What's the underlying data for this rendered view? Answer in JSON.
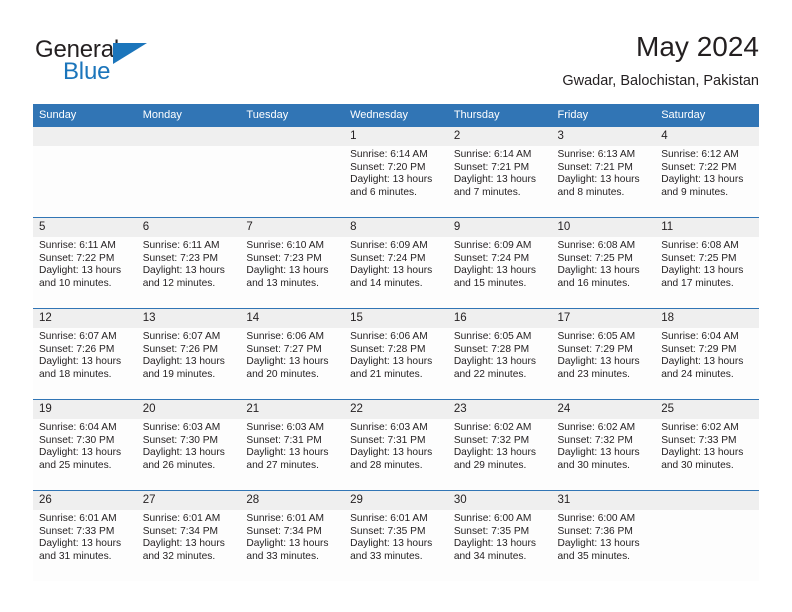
{
  "brand": {
    "name_top": "General",
    "name_bottom": "Blue",
    "accent_color": "#1b75bb"
  },
  "header": {
    "title": "May 2024",
    "subtitle": "Gwadar, Balochistan, Pakistan"
  },
  "theme": {
    "header_row_bg": "#3175b5",
    "daynum_bg": "#efefef",
    "grid_line": "#3175b5",
    "text": "#231f20"
  },
  "weekdays": [
    "Sunday",
    "Monday",
    "Tuesday",
    "Wednesday",
    "Thursday",
    "Friday",
    "Saturday"
  ],
  "labels": {
    "sunrise": "Sunrise:",
    "sunset": "Sunset:",
    "daylight": "Daylight:"
  },
  "weeks": [
    [
      {
        "day": "",
        "empty": true
      },
      {
        "day": "",
        "empty": true
      },
      {
        "day": "",
        "empty": true
      },
      {
        "day": "1",
        "sunrise": "Sunrise: 6:14 AM",
        "sunset": "Sunset: 7:20 PM",
        "daylight": "Daylight: 13 hours and 6 minutes."
      },
      {
        "day": "2",
        "sunrise": "Sunrise: 6:14 AM",
        "sunset": "Sunset: 7:21 PM",
        "daylight": "Daylight: 13 hours and 7 minutes."
      },
      {
        "day": "3",
        "sunrise": "Sunrise: 6:13 AM",
        "sunset": "Sunset: 7:21 PM",
        "daylight": "Daylight: 13 hours and 8 minutes."
      },
      {
        "day": "4",
        "sunrise": "Sunrise: 6:12 AM",
        "sunset": "Sunset: 7:22 PM",
        "daylight": "Daylight: 13 hours and 9 minutes."
      }
    ],
    [
      {
        "day": "5",
        "sunrise": "Sunrise: 6:11 AM",
        "sunset": "Sunset: 7:22 PM",
        "daylight": "Daylight: 13 hours and 10 minutes."
      },
      {
        "day": "6",
        "sunrise": "Sunrise: 6:11 AM",
        "sunset": "Sunset: 7:23 PM",
        "daylight": "Daylight: 13 hours and 12 minutes."
      },
      {
        "day": "7",
        "sunrise": "Sunrise: 6:10 AM",
        "sunset": "Sunset: 7:23 PM",
        "daylight": "Daylight: 13 hours and 13 minutes."
      },
      {
        "day": "8",
        "sunrise": "Sunrise: 6:09 AM",
        "sunset": "Sunset: 7:24 PM",
        "daylight": "Daylight: 13 hours and 14 minutes."
      },
      {
        "day": "9",
        "sunrise": "Sunrise: 6:09 AM",
        "sunset": "Sunset: 7:24 PM",
        "daylight": "Daylight: 13 hours and 15 minutes."
      },
      {
        "day": "10",
        "sunrise": "Sunrise: 6:08 AM",
        "sunset": "Sunset: 7:25 PM",
        "daylight": "Daylight: 13 hours and 16 minutes."
      },
      {
        "day": "11",
        "sunrise": "Sunrise: 6:08 AM",
        "sunset": "Sunset: 7:25 PM",
        "daylight": "Daylight: 13 hours and 17 minutes."
      }
    ],
    [
      {
        "day": "12",
        "sunrise": "Sunrise: 6:07 AM",
        "sunset": "Sunset: 7:26 PM",
        "daylight": "Daylight: 13 hours and 18 minutes."
      },
      {
        "day": "13",
        "sunrise": "Sunrise: 6:07 AM",
        "sunset": "Sunset: 7:26 PM",
        "daylight": "Daylight: 13 hours and 19 minutes."
      },
      {
        "day": "14",
        "sunrise": "Sunrise: 6:06 AM",
        "sunset": "Sunset: 7:27 PM",
        "daylight": "Daylight: 13 hours and 20 minutes."
      },
      {
        "day": "15",
        "sunrise": "Sunrise: 6:06 AM",
        "sunset": "Sunset: 7:28 PM",
        "daylight": "Daylight: 13 hours and 21 minutes."
      },
      {
        "day": "16",
        "sunrise": "Sunrise: 6:05 AM",
        "sunset": "Sunset: 7:28 PM",
        "daylight": "Daylight: 13 hours and 22 minutes."
      },
      {
        "day": "17",
        "sunrise": "Sunrise: 6:05 AM",
        "sunset": "Sunset: 7:29 PM",
        "daylight": "Daylight: 13 hours and 23 minutes."
      },
      {
        "day": "18",
        "sunrise": "Sunrise: 6:04 AM",
        "sunset": "Sunset: 7:29 PM",
        "daylight": "Daylight: 13 hours and 24 minutes."
      }
    ],
    [
      {
        "day": "19",
        "sunrise": "Sunrise: 6:04 AM",
        "sunset": "Sunset: 7:30 PM",
        "daylight": "Daylight: 13 hours and 25 minutes."
      },
      {
        "day": "20",
        "sunrise": "Sunrise: 6:03 AM",
        "sunset": "Sunset: 7:30 PM",
        "daylight": "Daylight: 13 hours and 26 minutes."
      },
      {
        "day": "21",
        "sunrise": "Sunrise: 6:03 AM",
        "sunset": "Sunset: 7:31 PM",
        "daylight": "Daylight: 13 hours and 27 minutes."
      },
      {
        "day": "22",
        "sunrise": "Sunrise: 6:03 AM",
        "sunset": "Sunset: 7:31 PM",
        "daylight": "Daylight: 13 hours and 28 minutes."
      },
      {
        "day": "23",
        "sunrise": "Sunrise: 6:02 AM",
        "sunset": "Sunset: 7:32 PM",
        "daylight": "Daylight: 13 hours and 29 minutes."
      },
      {
        "day": "24",
        "sunrise": "Sunrise: 6:02 AM",
        "sunset": "Sunset: 7:32 PM",
        "daylight": "Daylight: 13 hours and 30 minutes."
      },
      {
        "day": "25",
        "sunrise": "Sunrise: 6:02 AM",
        "sunset": "Sunset: 7:33 PM",
        "daylight": "Daylight: 13 hours and 30 minutes."
      }
    ],
    [
      {
        "day": "26",
        "sunrise": "Sunrise: 6:01 AM",
        "sunset": "Sunset: 7:33 PM",
        "daylight": "Daylight: 13 hours and 31 minutes."
      },
      {
        "day": "27",
        "sunrise": "Sunrise: 6:01 AM",
        "sunset": "Sunset: 7:34 PM",
        "daylight": "Daylight: 13 hours and 32 minutes."
      },
      {
        "day": "28",
        "sunrise": "Sunrise: 6:01 AM",
        "sunset": "Sunset: 7:34 PM",
        "daylight": "Daylight: 13 hours and 33 minutes."
      },
      {
        "day": "29",
        "sunrise": "Sunrise: 6:01 AM",
        "sunset": "Sunset: 7:35 PM",
        "daylight": "Daylight: 13 hours and 33 minutes."
      },
      {
        "day": "30",
        "sunrise": "Sunrise: 6:00 AM",
        "sunset": "Sunset: 7:35 PM",
        "daylight": "Daylight: 13 hours and 34 minutes."
      },
      {
        "day": "31",
        "sunrise": "Sunrise: 6:00 AM",
        "sunset": "Sunset: 7:36 PM",
        "daylight": "Daylight: 13 hours and 35 minutes."
      },
      {
        "day": "",
        "empty": true
      }
    ]
  ]
}
